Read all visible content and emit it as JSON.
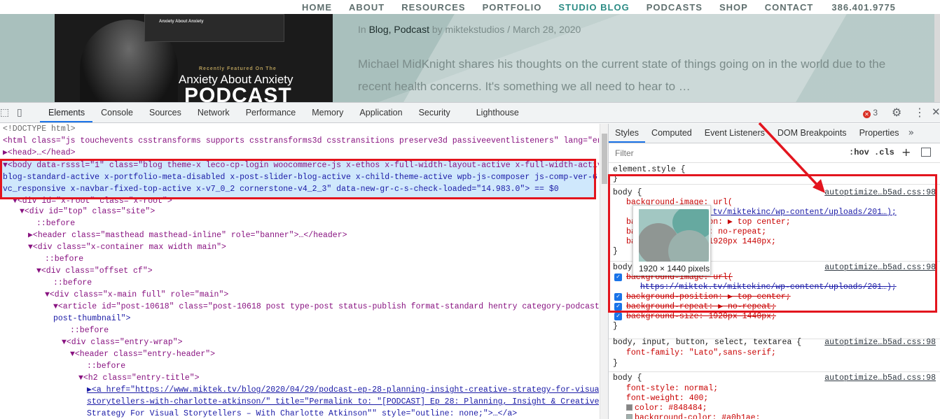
{
  "site": {
    "nav": [
      "HOME",
      "ABOUT",
      "RESOURCES",
      "PORTFOLIO",
      "STUDIO BLOG",
      "PODCASTS",
      "SHOP",
      "CONTACT",
      "386.401.9775"
    ],
    "active_nav": "STUDIO BLOG",
    "image_text": {
      "phone_title": "Anxiety About Anxiety",
      "recently": "Recently Featured On The",
      "show": "Anxiety About Anxiety",
      "podcast": "PODCAST"
    },
    "meta_prefix": "In ",
    "meta_cats": "Blog, Podcast",
    "meta_by": " by miktekstudios",
    "meta_sep": " / ",
    "meta_date": "March 28, 2020",
    "excerpt": "Michael MidKnight shares his thoughts on the current state of things going on in the world due to the recent health concerns. It's something we all need to hear to …"
  },
  "devtools": {
    "tabs": [
      "Elements",
      "Console",
      "Sources",
      "Network",
      "Performance",
      "Memory",
      "Application",
      "Security",
      "Lighthouse"
    ],
    "active_tab": "Elements",
    "error_count": "3",
    "elements_lines": [
      {
        "text": "<!DOCTYPE html>"
      },
      {
        "text": "<html class=\"js touchevents csstransforms supports csstransforms3d csstransitions preserve3d passiveeventlisteners\" lang=\"en-US\">"
      },
      {
        "text": "▶<head>…</head>"
      },
      {
        "text": "▼<body data-rsssl=\"1\" class=\"blog theme-x leco-cp-login woocommerce-js x-ethos x-full-width-layout-active x-full-width-active x"
      },
      {
        "text": "blog-standard-active x-portfolio-meta-disabled x-post-slider-blog-active x-child-theme-active wpb-js-composer js-comp-ver-6.4.1"
      },
      {
        "text": "vc_responsive x-navbar-fixed-top-active x-v7_0_2 cornerstone-v4_2_3\" data-new-gr-c-s-check-loaded=\"14.983.0\"> == $0"
      },
      {
        "text": "▼<div id=\"x-root\" class=\"x-root\">"
      },
      {
        "text": "▼<div id=\"top\" class=\"site\">"
      },
      {
        "text": "::before"
      },
      {
        "text": "▶<header class=\"masthead masthead-inline\" role=\"banner\">…</header>"
      },
      {
        "text": "▼<div class=\"x-container max width main\">"
      },
      {
        "text": "::before"
      },
      {
        "text": "▼<div class=\"offset cf\">"
      },
      {
        "text": "::before"
      },
      {
        "text": "▼<div class=\"x-main full\" role=\"main\">"
      },
      {
        "text": "▼<article id=\"post-10618\" class=\"post-10618 post type-post status-publish format-standard hentry category-podcast no-"
      },
      {
        "text": "post-thumbnail\">"
      },
      {
        "text": "::before"
      },
      {
        "text": "▼<div class=\"entry-wrap\">"
      },
      {
        "text": "▼<header class=\"entry-header\">"
      },
      {
        "text": "::before"
      },
      {
        "text": "▼<h2 class=\"entry-title\">"
      },
      {
        "text": "▶<a href=\"https://www.miktek.tv/blog/2020/04/29/podcast-ep-28-planning-insight-creative-strategy-for-visual-"
      },
      {
        "text": "storytellers-with-charlotte-atkinson/\" title=\"Permalink to: \"[PODCAST] Ep 28: Planning, Insight & Creative"
      },
      {
        "text": "Strategy For Visual Storytellers – With Charlotte Atkinson\"\" style=\"outline: none;\">…</a>"
      }
    ],
    "styles_tabs": [
      "Styles",
      "Computed",
      "Event Listeners",
      "DOM Breakpoints",
      "Properties"
    ],
    "filter_placeholder": "Filter",
    "hov": ":hov",
    "cls": ".cls",
    "element_style": "element.style {",
    "close_brace": "}",
    "rule1_selector": "body {",
    "rule1_source": "autoptimize…b5ad.css:98",
    "rule1_props": [
      "background-image: url(",
      "https://miktek.tv/miktekinc/wp-content/uploads/201…);",
      "background-position: ▶ top center;",
      "background-repeat: no-repeat;",
      "background-size: 1920px 1440px;"
    ],
    "rule2_selector": "body {",
    "rule2_source": "autoptimize…b5ad.css:98",
    "rule2_props": [
      "background-image: url(",
      "https://miktek.tv/miktekinc/wp-content/uploads/201…);",
      "background-position: ▶ top center;",
      "background-repeat: ▶ no-repeat;",
      "background-size: 1920px 1440px;"
    ],
    "rule3_selector": "body, input, button, select, textarea {",
    "rule3_source": "autoptimize…b5ad.css:98",
    "rule3_props": [
      "font-family: \"Lato\",sans-serif;"
    ],
    "rule4_selector": "body {",
    "rule4_source": "autoptimize…b5ad.css:98",
    "rule4_props": [
      "font-style: normal;",
      "font-weight: 400;",
      "color: #848484;",
      "background-color: #a0b1ae;"
    ],
    "tooltip_dims": "1920 × 1440 pixels",
    "colors": {
      "accent": "#1a73e8",
      "highlight": "#e3151e",
      "selected_row": "#cfe8fc",
      "text_color": "#848484",
      "bg_color": "#a0b1ae"
    }
  }
}
